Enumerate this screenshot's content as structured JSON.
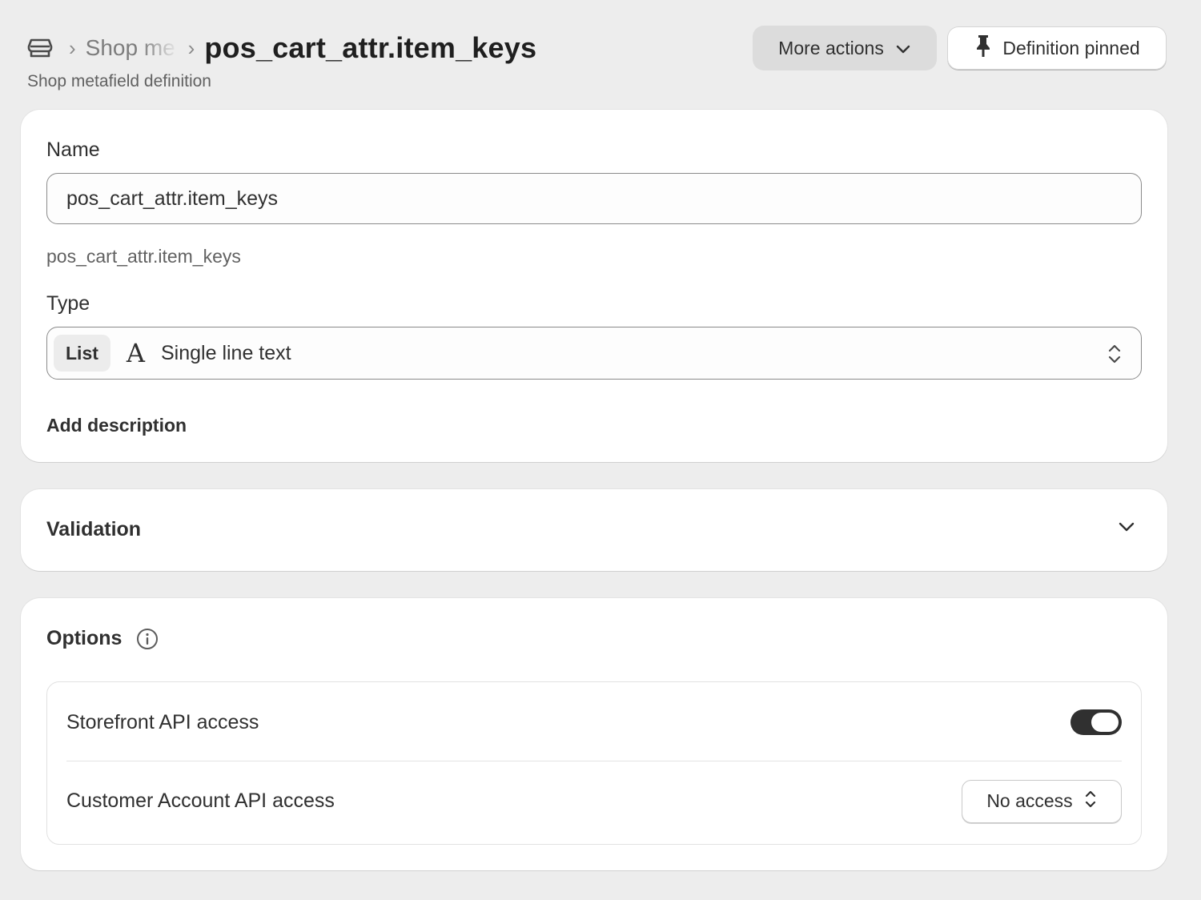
{
  "header": {
    "breadcrumb_parent": "Shop me",
    "title": "pos_cart_attr.item_keys",
    "subtitle": "Shop metafield definition",
    "more_actions_label": "More actions",
    "pinned_label": "Definition pinned",
    "separator": "›"
  },
  "details": {
    "name_label": "Name",
    "name_value": "pos_cart_attr.item_keys",
    "key_value": "pos_cart_attr.item_keys",
    "type_label": "Type",
    "type_chip": "List",
    "type_glyph": "A",
    "type_value": "Single line text",
    "add_description_label": "Add description"
  },
  "validation": {
    "title": "Validation"
  },
  "options": {
    "title": "Options",
    "storefront_label": "Storefront API access",
    "storefront_enabled": true,
    "customer_label": "Customer Account API access",
    "customer_value": "No access"
  },
  "icons": [
    "store-icon",
    "chevron-down-icon",
    "pin-icon",
    "up-down-icon",
    "info-icon"
  ]
}
